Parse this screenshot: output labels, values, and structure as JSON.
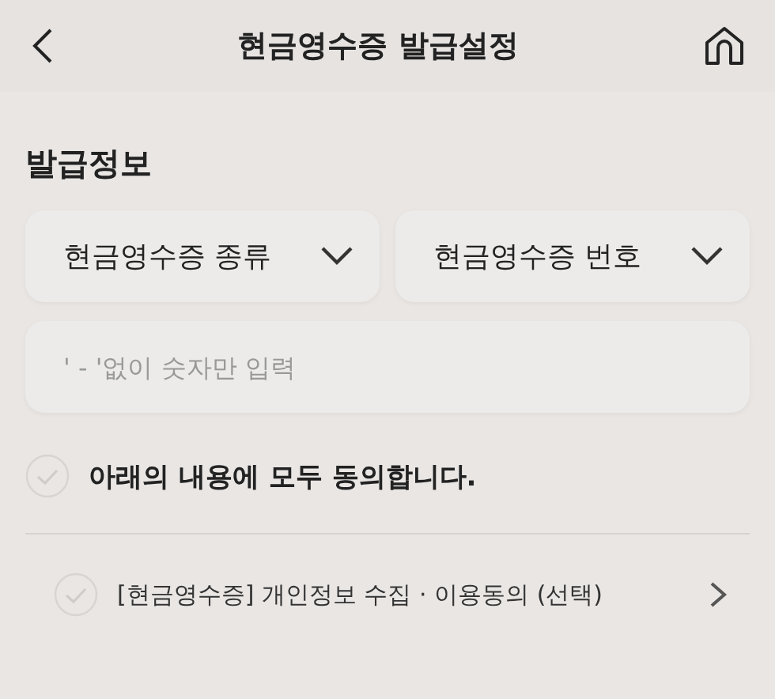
{
  "header": {
    "title": "현금영수증 발급설정"
  },
  "section": {
    "title": "발급정보"
  },
  "dropdowns": [
    {
      "label": "현금영수증 종류"
    },
    {
      "label": "현금영수증 번호"
    }
  ],
  "number_field": {
    "placeholder": "' - '없이 숫자만 입력"
  },
  "agree_all": {
    "label": "아래의 내용에 모두 동의합니다.",
    "checked": false
  },
  "consents": [
    {
      "label": "[현금영수증] 개인정보 수집 · 이용동의 (선택)",
      "checked": false
    }
  ]
}
